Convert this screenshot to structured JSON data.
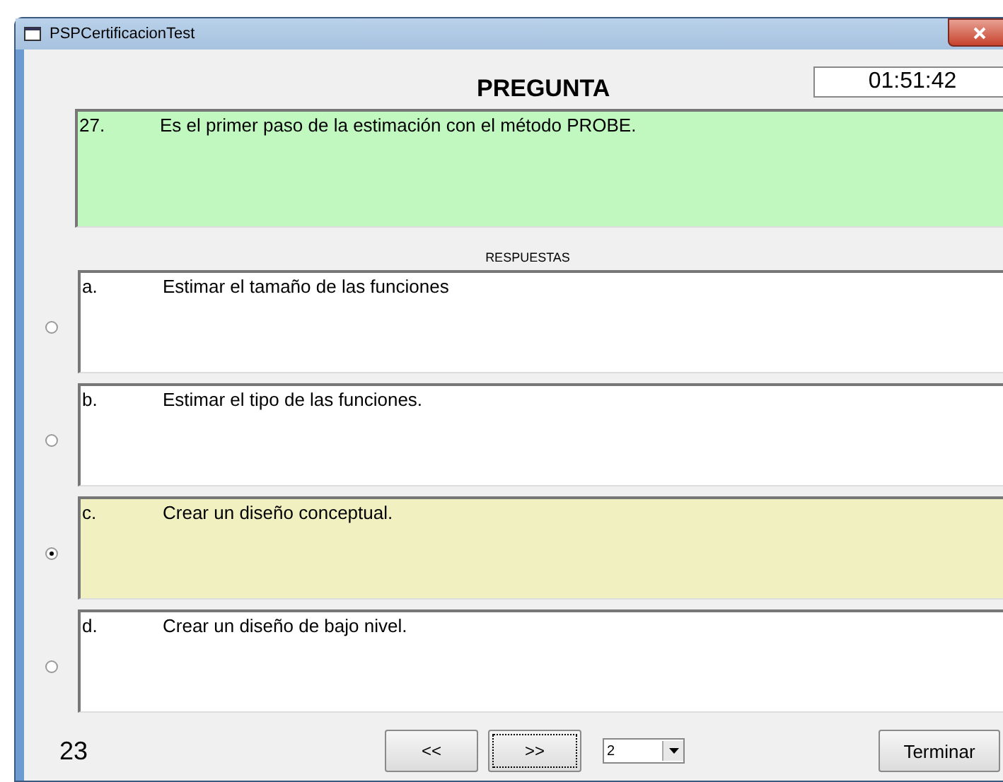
{
  "window": {
    "title": "PSPCertificacionTest"
  },
  "header": {
    "title": "PREGUNTA",
    "timer": "01:51:42"
  },
  "question": {
    "number": "27.",
    "text": "Es el primer paso de la estimación con el método PROBE."
  },
  "answers_label": "RESPUESTAS",
  "answers": [
    {
      "letter": "a.",
      "text": "Estimar el tamaño de las funciones",
      "selected": false
    },
    {
      "letter": "b.",
      "text": "Estimar el tipo de las funciones.",
      "selected": false
    },
    {
      "letter": "c.",
      "text": "Crear un diseño conceptual.",
      "selected": true
    },
    {
      "letter": "d.",
      "text": "Crear un diseño de bajo nivel.",
      "selected": false
    }
  ],
  "footer": {
    "count": "23",
    "prev": "<<",
    "next": ">>",
    "page": "2",
    "finish": "Terminar"
  }
}
